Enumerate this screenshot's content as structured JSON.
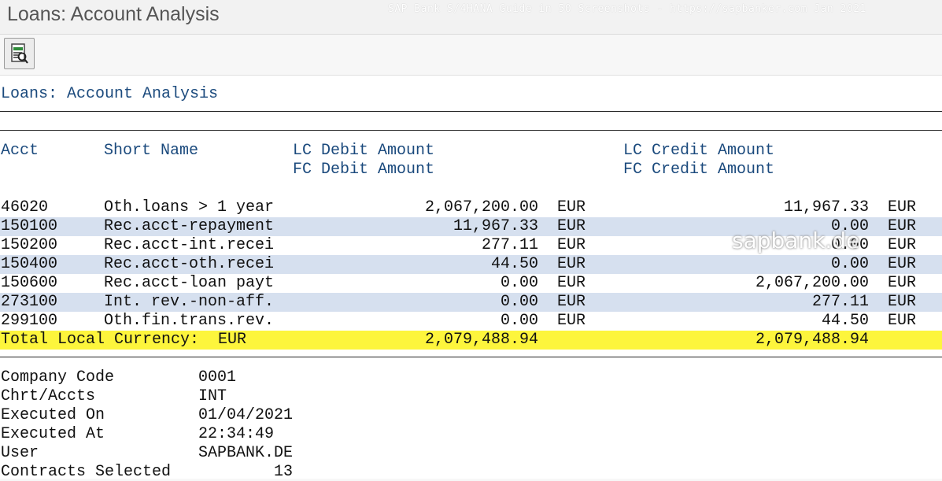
{
  "window": {
    "title": "Loans: Account Analysis",
    "watermark": "SAP Bank S/4HANA Guide in 50 Screenshots - https://sapbanker.com Jan 2021"
  },
  "toolbar": {
    "button_icon": "report-selection-icon"
  },
  "report": {
    "title": "Loans: Account Analysis",
    "headers": {
      "acct": "Acct",
      "short_name": "Short Name",
      "lc_debit": "LC Debit Amount",
      "fc_debit": "FC Debit Amount",
      "lc_credit": "LC Credit Amount",
      "fc_credit": "FC Credit Amount"
    },
    "rows": [
      {
        "acct": "46020",
        "name": "Oth.loans > 1 year",
        "debit": "2,067,200.00",
        "debit_cur": "EUR",
        "credit": "11,967.33",
        "credit_cur": "EUR"
      },
      {
        "acct": "150100",
        "name": "Rec.acct-repayment",
        "debit": "11,967.33",
        "debit_cur": "EUR",
        "credit": "0.00",
        "credit_cur": "EUR"
      },
      {
        "acct": "150200",
        "name": "Rec.acct-int.recei",
        "debit": "277.11",
        "debit_cur": "EUR",
        "credit": "0.00",
        "credit_cur": "EUR"
      },
      {
        "acct": "150400",
        "name": "Rec.acct-oth.recei",
        "debit": "44.50",
        "debit_cur": "EUR",
        "credit": "0.00",
        "credit_cur": "EUR"
      },
      {
        "acct": "150600",
        "name": "Rec.acct-loan payt",
        "debit": "0.00",
        "debit_cur": "EUR",
        "credit": "2,067,200.00",
        "credit_cur": "EUR"
      },
      {
        "acct": "273100",
        "name": "Int. rev.-non-aff.",
        "debit": "0.00",
        "debit_cur": "EUR",
        "credit": "277.11",
        "credit_cur": "EUR"
      },
      {
        "acct": "299100",
        "name": "Oth.fin.trans.rev.",
        "debit": "0.00",
        "debit_cur": "EUR",
        "credit": "44.50",
        "credit_cur": "EUR"
      }
    ],
    "total": {
      "label": "Total Local Currency:  EUR",
      "debit": "2,079,488.94",
      "credit": "2,079,488.94"
    },
    "info": [
      {
        "label": "Company Code",
        "value": "0001"
      },
      {
        "label": "Chrt/Accts",
        "value": "INT"
      },
      {
        "label": "Executed On",
        "value": "01/04/2021"
      },
      {
        "label": "Executed At",
        "value": "22:34:49"
      },
      {
        "label": "User",
        "value": "SAPBANK.DE"
      },
      {
        "label": "Contracts Selected",
        "value": "13"
      }
    ],
    "brand_watermark": "sapbank.de"
  },
  "colors": {
    "header_text": "#1b4a7d",
    "alt_row": "#d6e0ef",
    "total_row": "#fdf53c"
  }
}
